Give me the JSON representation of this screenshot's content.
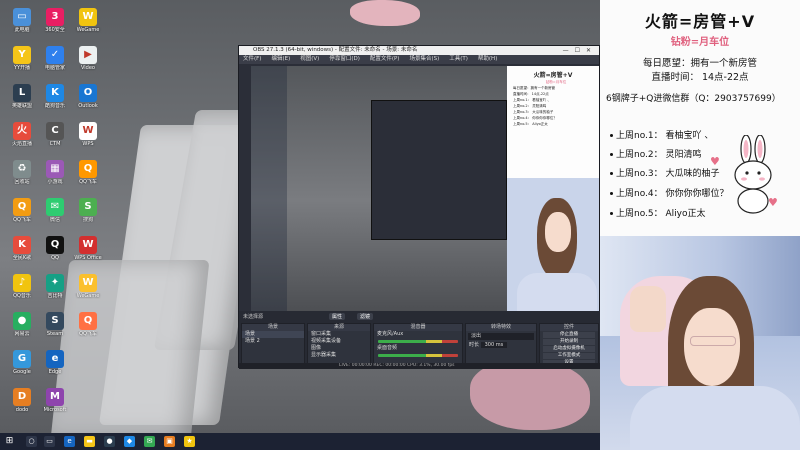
{
  "desktop": {
    "icons": [
      {
        "label": "此电脑",
        "color": "#4a90d9",
        "glyph": "▭"
      },
      {
        "label": "YY开播",
        "color": "#f5c518",
        "glyph": "Y"
      },
      {
        "label": "英雄联盟",
        "color": "#2c3e50",
        "glyph": "L"
      },
      {
        "label": "火焰直播",
        "color": "#e74c3c",
        "glyph": "火"
      },
      {
        "label": "回收站",
        "color": "#7f8c8d",
        "glyph": "♻"
      },
      {
        "label": "QQ飞车",
        "color": "#f39c12",
        "glyph": "Q"
      },
      {
        "label": "全民K歌",
        "color": "#e74c3c",
        "glyph": "K"
      },
      {
        "label": "QQ音乐",
        "color": "#f1c40f",
        "glyph": "♪"
      },
      {
        "label": "网易云",
        "color": "#27ae60",
        "glyph": "●"
      },
      {
        "label": "Google",
        "color": "#3498db",
        "glyph": "G"
      },
      {
        "label": "dodo",
        "color": "#e67e22",
        "glyph": "D"
      },
      {
        "label": "360安全",
        "color": "#e91e63",
        "glyph": "3"
      },
      {
        "label": "电脑管家",
        "color": "#2f80ed",
        "glyph": "✓"
      },
      {
        "label": "酷狗音乐",
        "color": "#1e88e5",
        "glyph": "K"
      },
      {
        "label": "CTM",
        "color": "#555555",
        "glyph": "C"
      },
      {
        "label": "小游戏",
        "color": "#9b59b6",
        "glyph": "▦"
      },
      {
        "label": "微信",
        "color": "#2ecc71",
        "glyph": "✉"
      },
      {
        "label": "QQ",
        "color": "#111111",
        "glyph": "Q"
      },
      {
        "label": "吉比特",
        "color": "#16a085",
        "glyph": "✦"
      },
      {
        "label": "Steam",
        "color": "#34495e",
        "glyph": "S"
      },
      {
        "label": "Edge",
        "color": "#1565c0",
        "glyph": "e"
      },
      {
        "label": "Microsoft",
        "color": "#8e44ad",
        "glyph": "M"
      },
      {
        "label": "WeGame",
        "color": "#f1c40f",
        "glyph": "W"
      },
      {
        "label": "Video",
        "color": "#ecf0f1",
        "glyph": "▶"
      },
      {
        "label": "Outlook",
        "color": "#1976d2",
        "glyph": "O"
      },
      {
        "label": "WPS",
        "color": "#ffffff",
        "glyph": "W"
      },
      {
        "label": "QQ飞车",
        "color": "#ff9800",
        "glyph": "Q"
      },
      {
        "label": "搜狗",
        "color": "#4caf50",
        "glyph": "S"
      },
      {
        "label": "WPS Office",
        "color": "#d32f2f",
        "glyph": "W"
      },
      {
        "label": "WeGame",
        "color": "#fbc02d",
        "glyph": "W"
      },
      {
        "label": "QQ飞车",
        "color": "#ff7043",
        "glyph": "Q"
      }
    ]
  },
  "obs": {
    "title": "OBS 27.1.3 (64-bit, windows) - 配置文件: 未命名 - 场景: 未命名",
    "menu": [
      "文件(F)",
      "编辑(E)",
      "视图(V)",
      "停靠窗口(D)",
      "配置文件(P)",
      "场景集合(S)",
      "工具(T)",
      "帮助(H)"
    ],
    "scene_label": "未选择源",
    "vt_buttons": [
      "属性",
      "滤镜"
    ],
    "docks": {
      "scenes": {
        "title": "场景",
        "items": [
          "场景",
          "场景 2"
        ]
      },
      "sources": {
        "title": "来源",
        "items": [
          "窗口采集",
          "视频采集设备",
          "图像",
          "显示器采集"
        ]
      },
      "mixer": {
        "title": "混音器",
        "channels": [
          "麦克风/Aux",
          "桌面音频"
        ]
      },
      "transitions": {
        "title": "转场特效",
        "type": "淡出",
        "duration_label": "时长",
        "duration": "300 ms"
      },
      "controls": {
        "title": "控件",
        "buttons": [
          "停止直播",
          "开始录制",
          "启动虚拟摄像机",
          "工作室模式",
          "设置",
          "退出"
        ]
      }
    },
    "status": "LIVE: 00:00:00   REC: 00:00:00   CPU: 3.1%, 30.00 fps"
  },
  "stream_info": {
    "title": "火箭=房管+V",
    "subtitle": "钻粉=月车位",
    "hope": "每日愿望：拥有一个新房管",
    "time": "直播时间： 14点-22点",
    "group": "6钢牌子+Q进微信群（Q：2903757699）",
    "ranks": [
      "上周no.1：  看柚宝吖 、",
      "上周no.2：  灵阳清鸣",
      "上周no.3：  大瓜味的柚子",
      "上周no.4：  你你你你哪位？",
      "上周no.5：  Aliyo正太"
    ]
  },
  "colors": {
    "accent_pink": "#e0607e",
    "obs_bg": "#2b2e38",
    "taskbar": "#1c2233"
  }
}
